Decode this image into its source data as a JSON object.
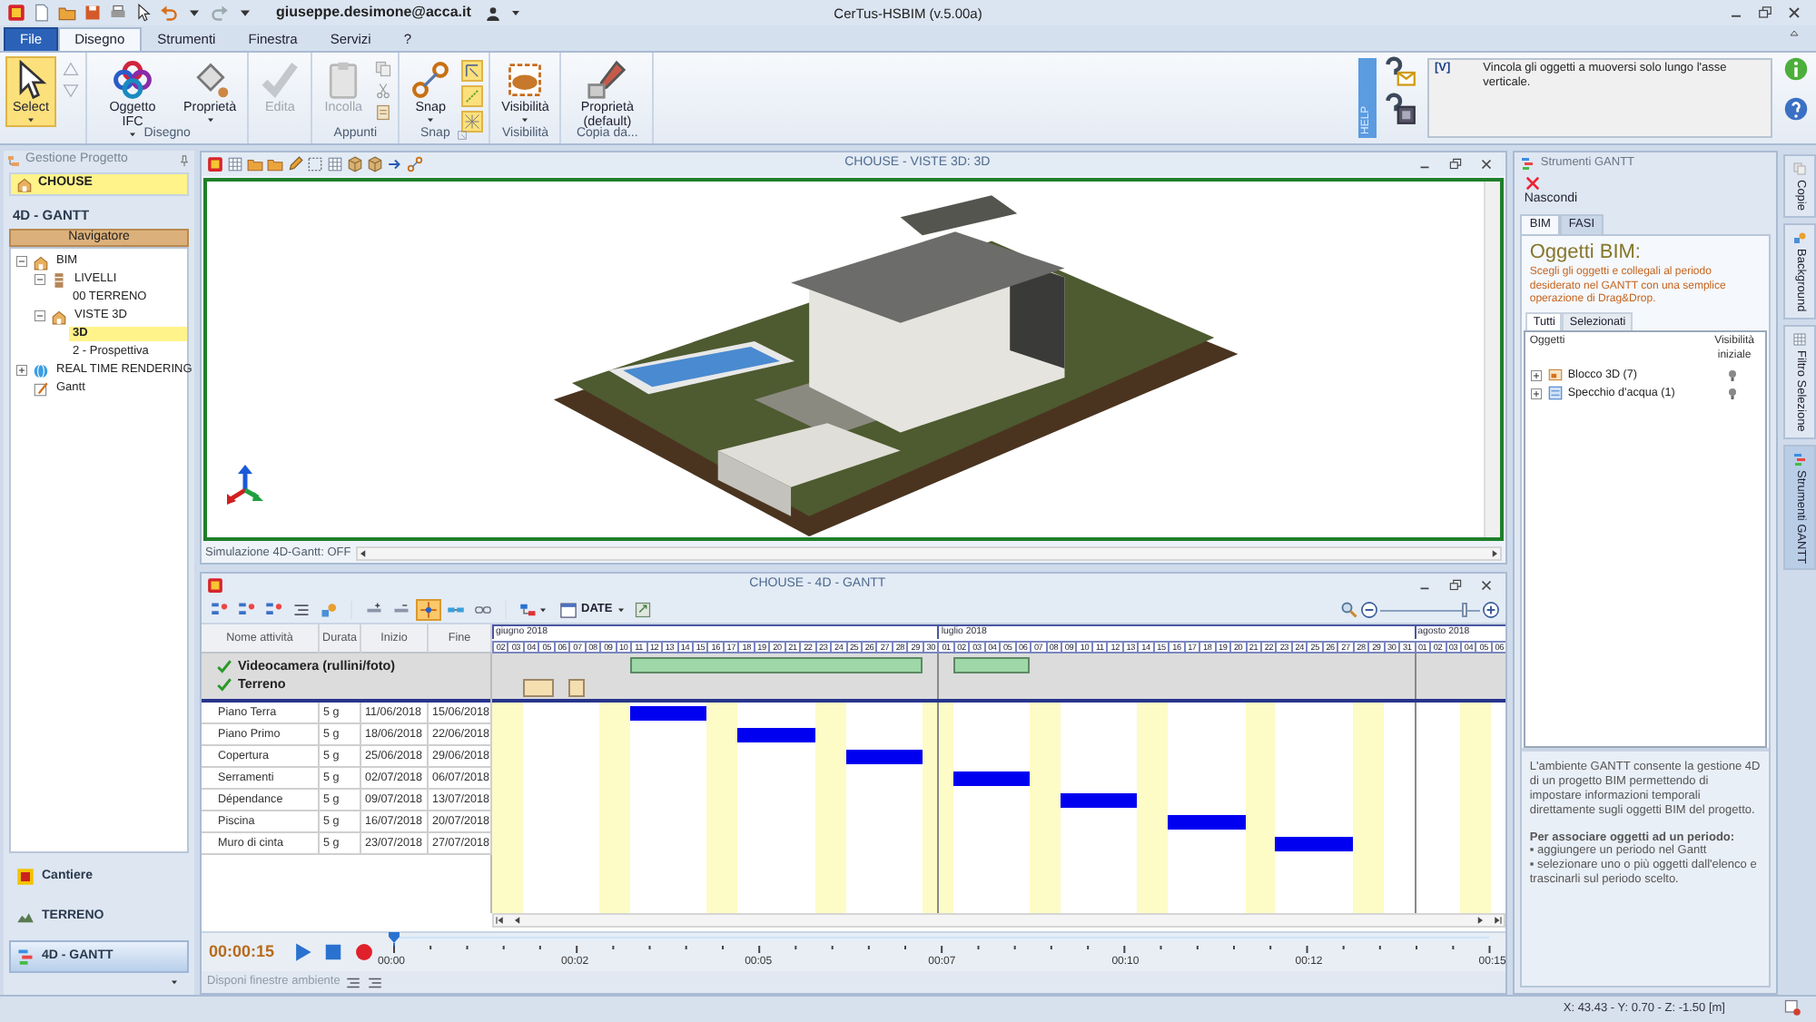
{
  "app": {
    "user": "giuseppe.desimone@acca.it",
    "title": "CerTus-HSBIM (v.5.00a)"
  },
  "ribbon_tabs": [
    {
      "label": "File",
      "kind": "file",
      "selected": false
    },
    {
      "label": "Disegno",
      "kind": "tab",
      "selected": true
    },
    {
      "label": "Strumenti",
      "kind": "tab",
      "selected": false
    },
    {
      "label": "Finestra",
      "kind": "tab",
      "selected": false
    },
    {
      "label": "Servizi",
      "kind": "tab",
      "selected": false
    },
    {
      "label": "?",
      "kind": "tab",
      "selected": false
    }
  ],
  "ribbon_groups": [
    {
      "buttons": [
        {
          "label": "Select",
          "dropdown": true,
          "selected": true,
          "disabled": false
        }
      ]
    },
    {
      "label": "Disegno",
      "buttons": [
        {
          "label": "Oggetto IFC",
          "dropdown": true,
          "selected": false,
          "disabled": false
        },
        {
          "label": "Proprietà",
          "dropdown": true,
          "selected": false,
          "disabled": false
        }
      ]
    },
    {
      "buttons": [
        {
          "label": "Edita",
          "dropdown": false,
          "selected": false,
          "disabled": true
        }
      ]
    },
    {
      "label": "Appunti",
      "buttons": [
        {
          "label": "Incolla",
          "dropdown": false,
          "selected": false,
          "disabled": true
        }
      ]
    },
    {
      "label": "Snap",
      "buttons": [
        {
          "label": "Snap",
          "dropdown": true,
          "selected": false,
          "disabled": false
        }
      ],
      "toggles": [
        {
          "on": true
        },
        {
          "on": true
        },
        {
          "on": true
        }
      ]
    },
    {
      "label": "Visibilità",
      "buttons": [
        {
          "label": "Visibilità",
          "dropdown": true,
          "selected": false,
          "disabled": false
        }
      ]
    },
    {
      "label": "Copia da...",
      "buttons": [
        {
          "label": "Proprietà (default)",
          "dropdown": false,
          "selected": false,
          "disabled": false
        }
      ]
    }
  ],
  "help": {
    "side_label": "HELP",
    "tag": "[V]",
    "text": "Vincola gli oggetti a muoversi solo lungo l'asse verticale."
  },
  "project_panel": {
    "title": "Gestione Progetto",
    "project": "CHOUSE",
    "section": "4D - GANTT",
    "navigator": "Navigatore",
    "tree": [
      {
        "label": "BIM",
        "expanded": true,
        "selected": false,
        "children": [
          {
            "label": "LIVELLI",
            "expanded": true,
            "selected": false,
            "children": [
              {
                "label": "00 TERRENO",
                "selected": false
              }
            ]
          },
          {
            "label": "VISTE 3D",
            "expanded": true,
            "selected": false,
            "children": [
              {
                "label": "3D",
                "selected": true
              },
              {
                "label": "2 - Prospettiva",
                "selected": false
              }
            ]
          }
        ]
      },
      {
        "label": "REAL TIME RENDERING",
        "expanded": false,
        "selected": false
      },
      {
        "label": "Gantt",
        "selected": false
      }
    ],
    "modules": [
      {
        "label": "Cantiere",
        "selected": false
      },
      {
        "label": "TERRENO",
        "selected": false
      },
      {
        "label": "4D - GANTT",
        "selected": true
      }
    ]
  },
  "view3d": {
    "title": "CHOUSE - VISTE 3D: 3D",
    "status": "Simulazione 4D-Gantt: OFF"
  },
  "gantt": {
    "title": "CHOUSE - 4D - GANTT",
    "tools": [
      {
        "selected": false
      },
      {
        "selected": false
      },
      {
        "selected": false
      },
      {
        "selected": false
      },
      {
        "selected": false
      },
      {
        "selected": false
      },
      {
        "selected": false
      },
      {
        "selected": true
      },
      {
        "selected": false
      },
      {
        "selected": false
      },
      {
        "selected": false
      }
    ],
    "date_button": "DATE",
    "zoom": {
      "level": 0.85
    },
    "columns": [
      "Nome attività",
      "Durata",
      "Inizio",
      "Fine"
    ],
    "phases": [
      {
        "label": "Videocamera (rullini/foto)",
        "checked": true
      },
      {
        "label": "Terreno",
        "checked": true
      }
    ],
    "tasks": [
      {
        "name": "Piano Terra",
        "duration": "5 g",
        "start": "11/06/2018",
        "end": "15/06/2018"
      },
      {
        "name": "Piano Primo",
        "duration": "5 g",
        "start": "18/06/2018",
        "end": "22/06/2018"
      },
      {
        "name": "Copertura",
        "duration": "5 g",
        "start": "25/06/2018",
        "end": "29/06/2018"
      },
      {
        "name": "Serramenti",
        "duration": "5 g",
        "start": "02/07/2018",
        "end": "06/07/2018"
      },
      {
        "name": "Dépendance",
        "duration": "5 g",
        "start": "09/07/2018",
        "end": "13/07/2018"
      },
      {
        "name": "Piscina",
        "duration": "5 g",
        "start": "16/07/2018",
        "end": "20/07/2018"
      },
      {
        "name": "Muro di cinta",
        "duration": "5 g",
        "start": "23/07/2018",
        "end": "27/07/2018"
      }
    ],
    "months": [
      {
        "label": "giugno 2018",
        "days": [
          {
            "d": "02",
            "weekend": true
          },
          {
            "d": "03",
            "weekend": true
          },
          {
            "d": "04",
            "weekend": false
          },
          {
            "d": "05",
            "weekend": false
          },
          {
            "d": "06",
            "weekend": false
          },
          {
            "d": "07",
            "weekend": false
          },
          {
            "d": "08",
            "weekend": false
          },
          {
            "d": "09",
            "weekend": true
          },
          {
            "d": "10",
            "weekend": true
          },
          {
            "d": "11",
            "weekend": false
          },
          {
            "d": "12",
            "weekend": false
          },
          {
            "d": "13",
            "weekend": false
          },
          {
            "d": "14",
            "weekend": false
          },
          {
            "d": "15",
            "weekend": false
          },
          {
            "d": "16",
            "weekend": true
          },
          {
            "d": "17",
            "weekend": true
          },
          {
            "d": "18",
            "weekend": false
          },
          {
            "d": "19",
            "weekend": false
          },
          {
            "d": "20",
            "weekend": false
          },
          {
            "d": "21",
            "weekend": false
          },
          {
            "d": "22",
            "weekend": false
          },
          {
            "d": "23",
            "weekend": true
          },
          {
            "d": "24",
            "weekend": true
          },
          {
            "d": "25",
            "weekend": false
          },
          {
            "d": "26",
            "weekend": false
          },
          {
            "d": "27",
            "weekend": false
          },
          {
            "d": "28",
            "weekend": false
          },
          {
            "d": "29",
            "weekend": false
          },
          {
            "d": "30",
            "weekend": true
          }
        ]
      },
      {
        "label": "luglio 2018",
        "days": [
          {
            "d": "01",
            "weekend": true
          },
          {
            "d": "02",
            "weekend": false
          },
          {
            "d": "03",
            "weekend": false
          },
          {
            "d": "04",
            "weekend": false
          },
          {
            "d": "05",
            "weekend": false
          },
          {
            "d": "06",
            "weekend": false
          },
          {
            "d": "07",
            "weekend": true
          },
          {
            "d": "08",
            "weekend": true
          },
          {
            "d": "09",
            "weekend": false
          },
          {
            "d": "10",
            "weekend": false
          },
          {
            "d": "11",
            "weekend": false
          },
          {
            "d": "12",
            "weekend": false
          },
          {
            "d": "13",
            "weekend": false
          },
          {
            "d": "14",
            "weekend": true
          },
          {
            "d": "15",
            "weekend": true
          },
          {
            "d": "16",
            "weekend": false
          },
          {
            "d": "17",
            "weekend": false
          },
          {
            "d": "18",
            "weekend": false
          },
          {
            "d": "19",
            "weekend": false
          },
          {
            "d": "20",
            "weekend": false
          },
          {
            "d": "21",
            "weekend": true
          },
          {
            "d": "22",
            "weekend": true
          },
          {
            "d": "23",
            "weekend": false
          },
          {
            "d": "24",
            "weekend": false
          },
          {
            "d": "25",
            "weekend": false
          },
          {
            "d": "26",
            "weekend": false
          },
          {
            "d": "27",
            "weekend": false
          },
          {
            "d": "28",
            "weekend": true
          },
          {
            "d": "29",
            "weekend": true
          },
          {
            "d": "30",
            "weekend": false
          },
          {
            "d": "31",
            "weekend": false
          }
        ]
      },
      {
        "label": "agosto 2018",
        "days": [
          {
            "d": "01",
            "weekend": false
          },
          {
            "d": "02",
            "weekend": false
          },
          {
            "d": "03",
            "weekend": false
          },
          {
            "d": "04",
            "weekend": true
          },
          {
            "d": "05",
            "weekend": true
          },
          {
            "d": "06",
            "weekend": false
          }
        ]
      }
    ],
    "player": {
      "time": "00:00:15",
      "level": 0,
      "ticks": [
        "00:00",
        "00:02",
        "00:05",
        "00:07",
        "00:10",
        "00:12",
        "00:15"
      ]
    },
    "layout_label": "Disponi finestre ambiente"
  },
  "gantt_tools": {
    "title": "Strumenti GANTT",
    "hide_button": "Nascondi",
    "tabs": [
      {
        "label": "BIM",
        "selected": true
      },
      {
        "label": "FASI",
        "selected": false
      }
    ],
    "heading": "Oggetti BIM:",
    "intro": "Scegli gli oggetti e collegali al periodo desiderato nel GANTT con una semplice operazione di Drag&Drop.",
    "filter_tabs": [
      {
        "label": "Tutti",
        "selected": true
      },
      {
        "label": "Selezionati",
        "selected": false
      }
    ],
    "columns": [
      "Oggetti",
      "Visibilità iniziale"
    ],
    "objects": [
      {
        "label": "Blocco 3D (7)",
        "expanded": false
      },
      {
        "label": "Specchio d'acqua (1)",
        "expanded": false
      }
    ],
    "help_text": "L'ambiente GANTT consente la gestione 4D di un progetto BIM permettendo di impostare informazioni temporali direttamente sugli oggetti BIM del progetto.",
    "help_heading": "Per associare oggetti ad un periodo:",
    "help_steps": [
      "▪ aggiungere un periodo nel Gantt",
      "▪ selezionare uno o più oggetti dall'elenco e trascinarli sul periodo scelto."
    ]
  },
  "side_tabs": [
    {
      "label": "Copie",
      "selected": false
    },
    {
      "label": "Background",
      "selected": false
    },
    {
      "label": "Filtro Selezione",
      "selected": false
    },
    {
      "label": "Strumenti GANTT",
      "selected": true
    }
  ],
  "status_bar": {
    "coordinates": "X: 43.43 - Y: 0.70 - Z: -1.50 [m]"
  }
}
